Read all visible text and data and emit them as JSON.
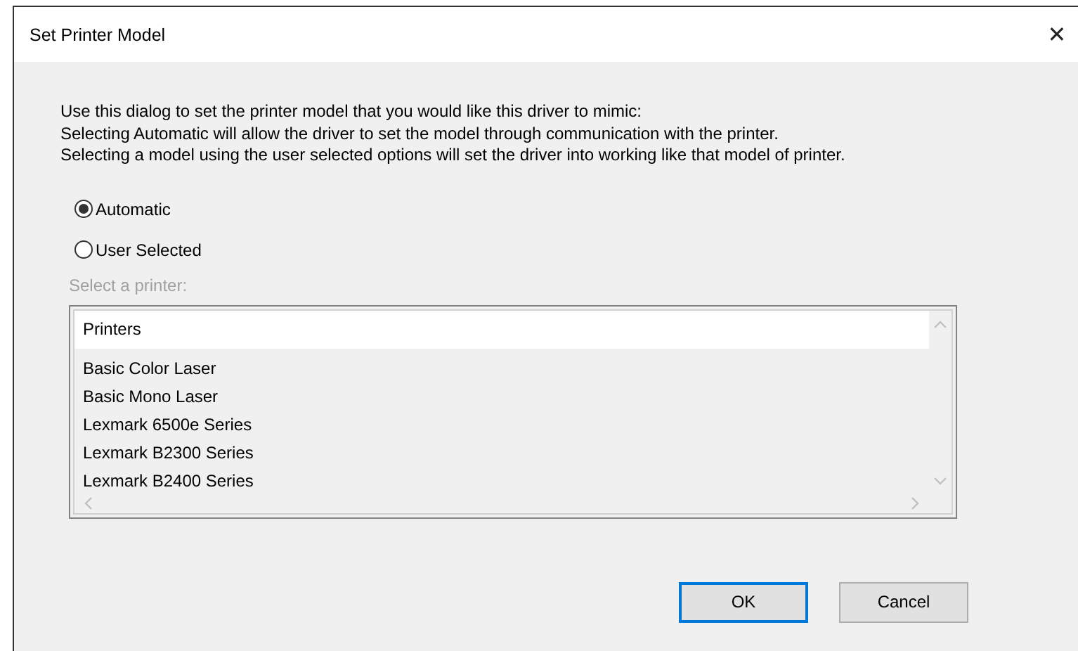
{
  "window": {
    "title": "Set Printer Model",
    "close": "✕"
  },
  "description": [
    "Use this dialog to set the printer model that you would like this driver to mimic:",
    "Selecting Automatic will allow the driver to set the model through communication with the printer.",
    "Selecting a model using the user selected options will set the driver into working like that model of printer."
  ],
  "mode_options": [
    {
      "label": "Automatic",
      "selected": true
    },
    {
      "label": "User Selected",
      "selected": false
    }
  ],
  "printer_list": {
    "label": "Select a printer:",
    "disabled": true,
    "header": "Printers",
    "items": [
      "Basic Color Laser",
      "Basic Mono Laser",
      "Lexmark 6500e Series",
      "Lexmark B2300 Series",
      "Lexmark B2400 Series"
    ]
  },
  "buttons": [
    {
      "label": "OK",
      "focused": true
    },
    {
      "label": "Cancel",
      "focused": false
    }
  ]
}
